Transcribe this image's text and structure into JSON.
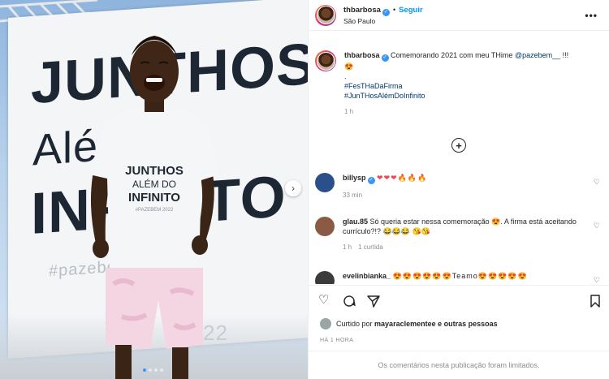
{
  "post": {
    "username": "thbarbosa",
    "follow_label": "Seguir",
    "separator": "•",
    "location": "São Paulo",
    "more": "•••"
  },
  "photo": {
    "banner_line1": "JUNTHOS",
    "banner_line2": "Além",
    "banner_line3": "INFINITO",
    "banner_hashtag": "#pazebem",
    "banner_year": "22",
    "shirt_line1": "JUNTHOS",
    "shirt_line2": "ALÉM DO",
    "shirt_line3": "INFINITO",
    "shirt_small": "#PAZEBEM 2022",
    "next_arrow": "›"
  },
  "caption": {
    "username": "thbarbosa",
    "text": "Comemorando 2021 com meu THime",
    "mention": "@pazebem__",
    "trailing": "!!!",
    "emoji": "😍",
    "dot": ".",
    "hashtag1": "#FesTHaDaFirma",
    "hashtag2": "#JunTHosAlémDoInfinito",
    "time": "1 h"
  },
  "load_more_icon": "+",
  "comments": [
    {
      "user": "billysp",
      "text": "❤❤❤🔥🔥🔥",
      "time": "33 min",
      "reply": ""
    },
    {
      "user": "glau.85",
      "text": "Só queria estar nessa comemoração 😍. A firma está aceitando currículo?!? 😂😂😂 😘😘",
      "time": "1 h",
      "reply": "1 curtida"
    },
    {
      "user": "evelinbianka_",
      "text": "😍😍😍😍😍😍Teamo😍😍😍😍😍",
      "time": "",
      "reply": ""
    }
  ],
  "liked_by": {
    "prefix": "Curtido por",
    "user": "mayaraclementee",
    "suffix": "e outras pessoas"
  },
  "date_label": "HÁ 1 HORA",
  "comments_limited": "Os comentários nesta publicação foram limitados.",
  "icons": {
    "like": "heart-outline-icon",
    "comment": "comment-icon",
    "share": "paper-plane-icon",
    "save": "bookmark-icon"
  }
}
